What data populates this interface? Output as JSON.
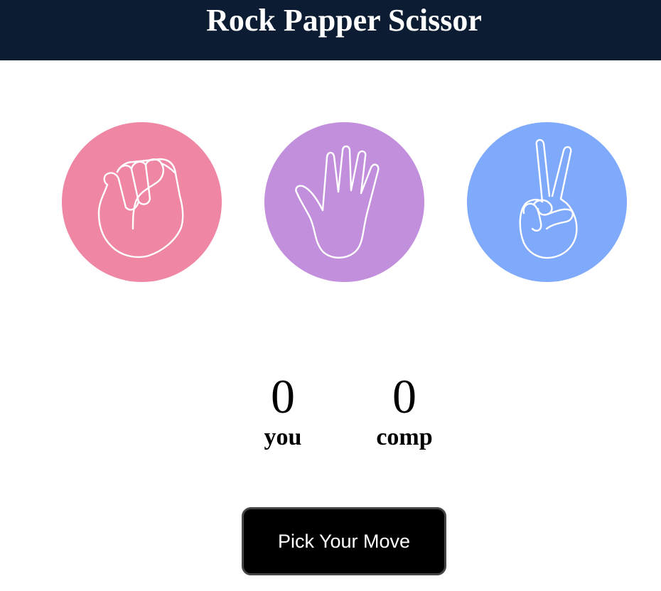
{
  "header": {
    "title": "Rock Papper Scissor"
  },
  "choices": [
    {
      "id": "rock",
      "icon": "fist-icon",
      "color": "#ef86a3"
    },
    {
      "id": "paper",
      "icon": "open-hand-icon",
      "color": "#c28fdc"
    },
    {
      "id": "scissor",
      "icon": "peace-sign-icon",
      "color": "#7faafc"
    }
  ],
  "scoreboard": {
    "user": {
      "score": "0",
      "label": "you"
    },
    "comp": {
      "score": "0",
      "label": "comp"
    }
  },
  "message": {
    "text": "Pick Your Move"
  },
  "colors": {
    "header_bg": "#0b1c33",
    "message_bg": "#000000"
  }
}
